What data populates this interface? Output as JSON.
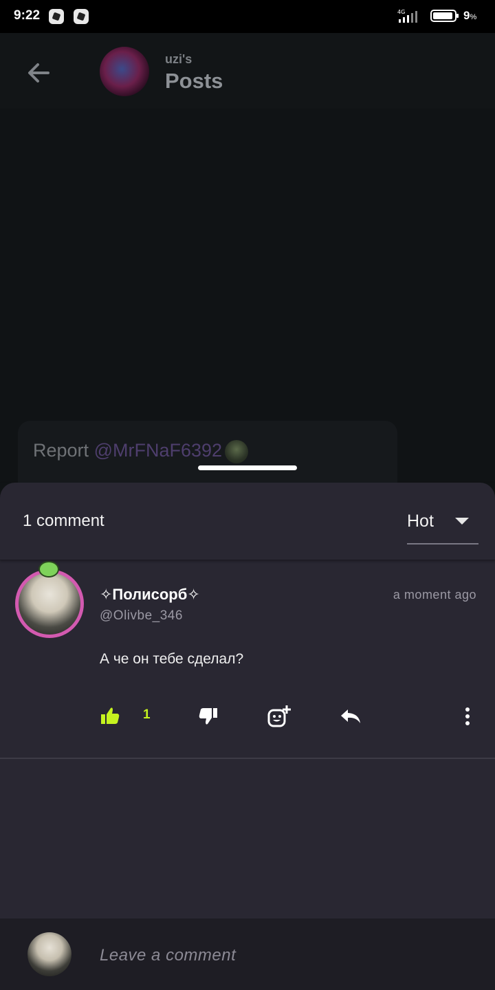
{
  "status_bar": {
    "time": "9:22",
    "network": "4G",
    "battery_percent": "9",
    "battery_suffix": "%"
  },
  "header": {
    "subtitle": "uzi's",
    "title": "Posts"
  },
  "post_preview": {
    "prefix": "Report",
    "mention": "@MrFNaF6392"
  },
  "comments_sheet": {
    "count_label": "1 comment",
    "sort": {
      "selected": "Hot"
    },
    "comments": [
      {
        "display_name": "✧Полисорб✧",
        "username": "@Olivbe_346",
        "time": "a moment ago",
        "text": "А че он тебе сделал?",
        "likes": "1"
      }
    ]
  },
  "composer": {
    "placeholder": "Leave a comment"
  },
  "colors": {
    "like_accent": "#c6f31f",
    "sheet_bg": "#292732",
    "avatar_ring": "#d35ab0"
  }
}
